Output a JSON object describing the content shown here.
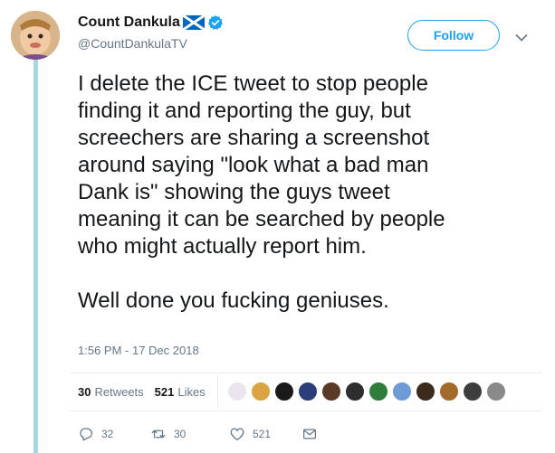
{
  "tweet": {
    "author": {
      "display_name": "Count Dankula",
      "handle": "@CountDankulaTV",
      "verified": true,
      "flag_icon": "scotland-flag-icon"
    },
    "follow_label": "Follow",
    "text_paragraph_1": "I delete the ICE tweet to stop people\nfinding it and reporting the guy, but\nscreechers are sharing a screenshot\naround saying \"look what a bad man\nDank is\" showing the guys tweet\nmeaning it can be searched by people\nwho might actually report him.",
    "text_paragraph_2": "Well done you fucking geniuses.",
    "timestamp": "1:56 PM - 17 Dec 2018",
    "stats": {
      "retweets_count": "30",
      "retweets_label": "Retweets",
      "likes_count": "521",
      "likes_label": "Likes"
    },
    "actions": {
      "reply_count": "32",
      "retweet_count": "30",
      "like_count": "521"
    }
  },
  "colors": {
    "accent": "#1da1f2",
    "thread_line": "#a9d4e8",
    "muted_text": "#657786",
    "liker_avatars": [
      "#e9e4ee",
      "#d9a441",
      "#1a1a1a",
      "#2c3e7a",
      "#5a3a26",
      "#2e2e2e",
      "#2f7d3a",
      "#6e9bd8",
      "#3b2a1e",
      "#a36b2a",
      "#3d3d3d",
      "#8a8a8a"
    ]
  }
}
